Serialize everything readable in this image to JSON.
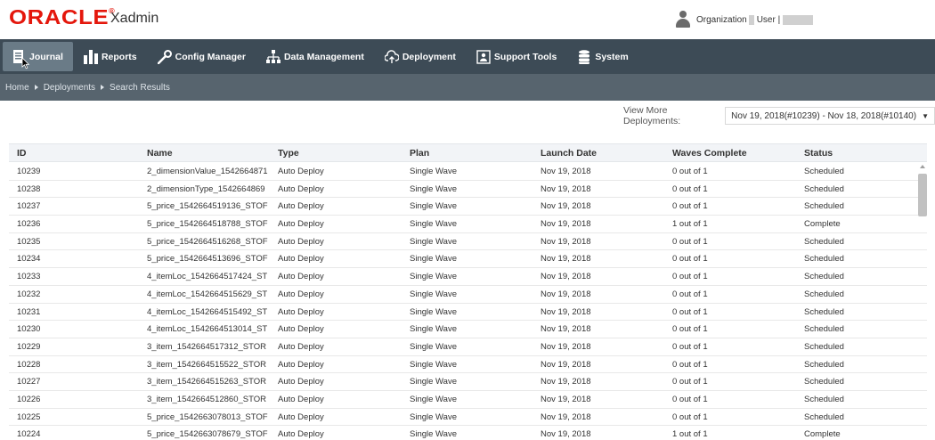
{
  "header": {
    "logo": "ORACLE",
    "app_name": "Xadmin",
    "organization_label": "Organization",
    "user_label": "User |"
  },
  "nav": {
    "items": [
      {
        "label": "Journal",
        "icon": "journal-icon",
        "active": true
      },
      {
        "label": "Reports",
        "icon": "bar-chart-icon"
      },
      {
        "label": "Config Manager",
        "icon": "wrench-icon"
      },
      {
        "label": "Data Management",
        "icon": "hierarchy-icon"
      },
      {
        "label": "Deployment",
        "icon": "cloud-upload-icon"
      },
      {
        "label": "Support Tools",
        "icon": "support-icon"
      },
      {
        "label": "System",
        "icon": "database-icon"
      }
    ]
  },
  "breadcrumb": {
    "items": [
      "Home",
      "Deployments",
      "Search Results"
    ]
  },
  "view_more": {
    "label": "View More Deployments:",
    "selected": "Nov 19, 2018(#10239) - Nov 18, 2018(#10140)"
  },
  "table": {
    "columns": [
      "ID",
      "Name",
      "Type",
      "Plan",
      "Launch Date",
      "Waves Complete",
      "Status"
    ],
    "rows": [
      {
        "id": "10239",
        "name": "2_dimensionValue_1542664871",
        "type": "Auto Deploy",
        "plan": "Single Wave",
        "date": "Nov 19, 2018",
        "waves": "0 out of 1",
        "status": "Scheduled"
      },
      {
        "id": "10238",
        "name": "2_dimensionType_1542664869",
        "type": "Auto Deploy",
        "plan": "Single Wave",
        "date": "Nov 19, 2018",
        "waves": "0 out of 1",
        "status": "Scheduled"
      },
      {
        "id": "10237",
        "name": "5_price_1542664519136_STOF",
        "type": "Auto Deploy",
        "plan": "Single Wave",
        "date": "Nov 19, 2018",
        "waves": "0 out of 1",
        "status": "Scheduled"
      },
      {
        "id": "10236",
        "name": "5_price_1542664518788_STOF",
        "type": "Auto Deploy",
        "plan": "Single Wave",
        "date": "Nov 19, 2018",
        "waves": "1 out of 1",
        "status": "Complete"
      },
      {
        "id": "10235",
        "name": "5_price_1542664516268_STOF",
        "type": "Auto Deploy",
        "plan": "Single Wave",
        "date": "Nov 19, 2018",
        "waves": "0 out of 1",
        "status": "Scheduled"
      },
      {
        "id": "10234",
        "name": "5_price_1542664513696_STOF",
        "type": "Auto Deploy",
        "plan": "Single Wave",
        "date": "Nov 19, 2018",
        "waves": "0 out of 1",
        "status": "Scheduled"
      },
      {
        "id": "10233",
        "name": "4_itemLoc_1542664517424_ST",
        "type": "Auto Deploy",
        "plan": "Single Wave",
        "date": "Nov 19, 2018",
        "waves": "0 out of 1",
        "status": "Scheduled"
      },
      {
        "id": "10232",
        "name": "4_itemLoc_1542664515629_ST",
        "type": "Auto Deploy",
        "plan": "Single Wave",
        "date": "Nov 19, 2018",
        "waves": "0 out of 1",
        "status": "Scheduled"
      },
      {
        "id": "10231",
        "name": "4_itemLoc_1542664515492_ST",
        "type": "Auto Deploy",
        "plan": "Single Wave",
        "date": "Nov 19, 2018",
        "waves": "0 out of 1",
        "status": "Scheduled"
      },
      {
        "id": "10230",
        "name": "4_itemLoc_1542664513014_ST",
        "type": "Auto Deploy",
        "plan": "Single Wave",
        "date": "Nov 19, 2018",
        "waves": "0 out of 1",
        "status": "Scheduled"
      },
      {
        "id": "10229",
        "name": "3_item_1542664517312_STOR",
        "type": "Auto Deploy",
        "plan": "Single Wave",
        "date": "Nov 19, 2018",
        "waves": "0 out of 1",
        "status": "Scheduled"
      },
      {
        "id": "10228",
        "name": "3_item_1542664515522_STOR",
        "type": "Auto Deploy",
        "plan": "Single Wave",
        "date": "Nov 19, 2018",
        "waves": "0 out of 1",
        "status": "Scheduled"
      },
      {
        "id": "10227",
        "name": "3_item_1542664515263_STOR",
        "type": "Auto Deploy",
        "plan": "Single Wave",
        "date": "Nov 19, 2018",
        "waves": "0 out of 1",
        "status": "Scheduled"
      },
      {
        "id": "10226",
        "name": "3_item_1542664512860_STOR",
        "type": "Auto Deploy",
        "plan": "Single Wave",
        "date": "Nov 19, 2018",
        "waves": "0 out of 1",
        "status": "Scheduled"
      },
      {
        "id": "10225",
        "name": "5_price_1542663078013_STOF",
        "type": "Auto Deploy",
        "plan": "Single Wave",
        "date": "Nov 19, 2018",
        "waves": "0 out of 1",
        "status": "Scheduled"
      },
      {
        "id": "10224",
        "name": "5_price_1542663078679_STOF",
        "type": "Auto Deploy",
        "plan": "Single Wave",
        "date": "Nov 19, 2018",
        "waves": "1 out of 1",
        "status": "Complete"
      }
    ]
  },
  "colors": {
    "brand_red": "#e4170c",
    "nav_bg": "#3d4b56",
    "nav_active": "#6a7b87",
    "breadcrumb_bg": "#57646e"
  }
}
